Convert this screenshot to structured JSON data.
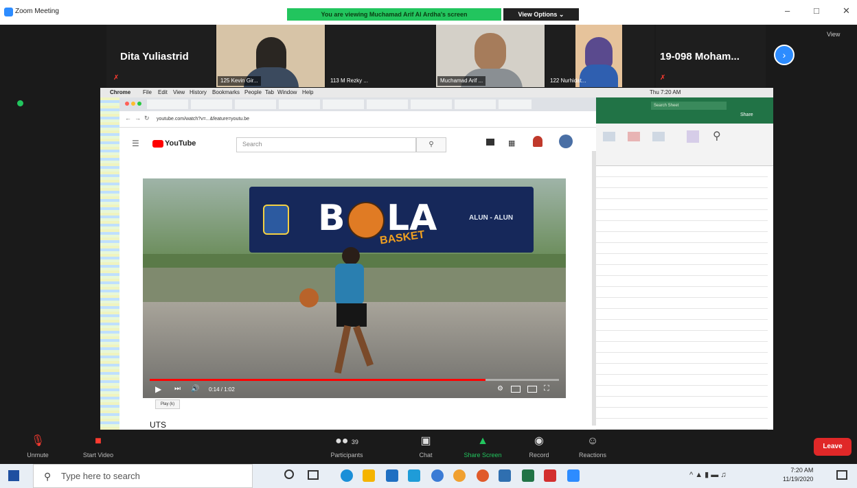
{
  "window": {
    "title": "Zoom Meeting",
    "banner": "You are viewing Muchamad Arif Al Ardha's screen",
    "view_options": "View Options ⌄",
    "controls": [
      "–",
      "□",
      "✕"
    ]
  },
  "participants": {
    "tile1_name": "Dita Yuliastrid",
    "tile2_label": "125 Kevin Gir...",
    "tile3_label": "113 M Rezky ...",
    "tile4_label": "Muchamad Arif ...",
    "tile5_label": "122 Nurhidat...",
    "tile6_name": "19-098  Moham...",
    "next_button": "›",
    "view_label": "View"
  },
  "mac_menu": [
    "Chrome",
    "File",
    "Edit",
    "View",
    "History",
    "Bookmarks",
    "People",
    "Tab",
    "Window",
    "Help"
  ],
  "mac_status": "Thu 7:20 AM",
  "browser": {
    "url": "youtube.com/watch?v=...&feature=youtu.be",
    "yt_logo": "YouTube",
    "search_placeholder": "Search",
    "video_title": "UTS",
    "banner_text_1": "B",
    "banner_text_2": "LA",
    "banner_sub": "BASKET",
    "banner_right": "ALUN - ALUN",
    "tooltip": "Play (k)",
    "time": "0:14 / 1:02"
  },
  "excel": {
    "search": "Search Sheet",
    "share": "Share"
  },
  "toolbar": {
    "unmute": "Unmute",
    "start_video": "Start Video",
    "participants": "Participants",
    "participants_count": "39",
    "chat": "Chat",
    "share_screen": "Share Screen",
    "record": "Record",
    "reactions": "Reactions",
    "leave": "Leave"
  },
  "taskbar": {
    "search_placeholder": "Type here to search",
    "time": "7:20 AM",
    "date": "11/19/2020"
  },
  "colors": {
    "zoom_blue": "#2d8cff",
    "banner_green": "#22c55e",
    "leave_red": "#e02828",
    "excel_green": "#217346"
  }
}
